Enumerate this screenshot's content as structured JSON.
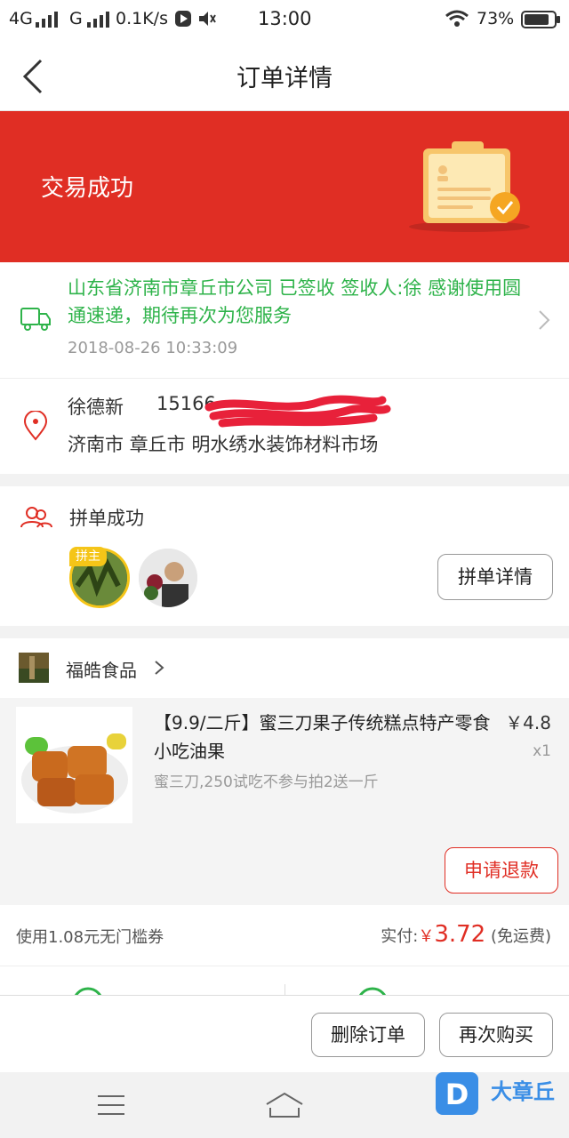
{
  "status_bar": {
    "signal1": "4G",
    "signal2": "G",
    "speed": "0.1K/s",
    "time": "13:00",
    "battery": "73%"
  },
  "nav": {
    "title": "订单详情"
  },
  "banner": {
    "status": "交易成功"
  },
  "logistics": {
    "message": "山东省济南市章丘市公司 已签收 签收人:徐 感谢使用圆通速递，期待再次为您服务",
    "time": "2018-08-26 10:33:09"
  },
  "address": {
    "name": "徐德新",
    "phone": "15166",
    "line": "济南市 章丘市 明水绣水装饰材料市场"
  },
  "group": {
    "title": "拼单成功",
    "host_badge": "拼主",
    "detail_button": "拼单详情"
  },
  "shop": {
    "name": "福皓食品"
  },
  "product": {
    "title": "【9.9/二斤】蜜三刀果子传统糕点特产零食小吃油果",
    "price": "￥4.8",
    "qty": "x1",
    "spec": "蜜三刀,250试吃不参与拍2送一斤",
    "refund_button": "申请退款"
  },
  "payment": {
    "coupon": "使用1.08元无门槛券",
    "paid_label": "实付:",
    "currency": "￥",
    "amount": "3.72",
    "shipping": "(免运费)"
  },
  "actions": {
    "delete": "删除订单",
    "rebuy": "再次购买"
  },
  "watermark": {
    "text": "大章丘"
  },
  "colors": {
    "brand_red": "#e02e24",
    "logistics_green": "#2eb34a"
  }
}
